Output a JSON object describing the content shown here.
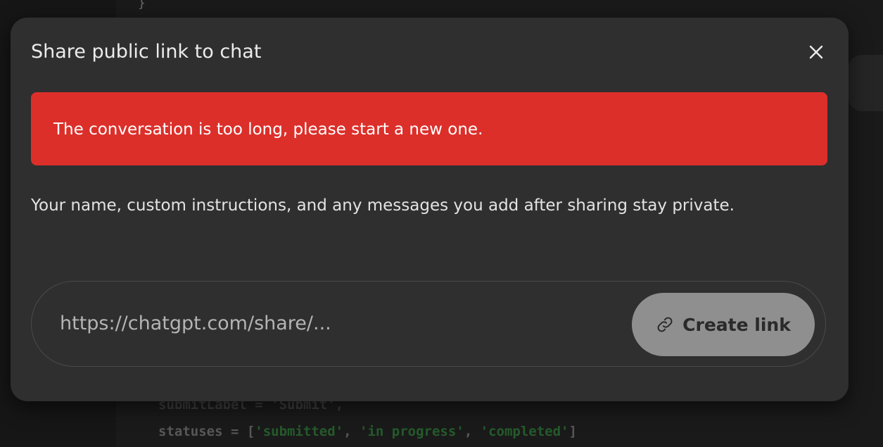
{
  "background_code": {
    "line1": "submitLabel = 'Submit',",
    "line2_prefix": "statuses = [",
    "status1": "'submitted'",
    "status2": "'in progress'",
    "status3": "'completed'",
    "line2_suffix": "]"
  },
  "dialog": {
    "title": "Share public link to chat",
    "close_icon": "close-icon",
    "error_message": "The conversation is too long, please start a new one.",
    "privacy_note": "Your name, custom instructions, and any messages you add after sharing stay private.",
    "link_placeholder": "https://chatgpt.com/share/...",
    "create_button_label": "Create link",
    "create_button_icon": "link-icon"
  },
  "colors": {
    "error_banner": "#dc2f2a",
    "dialog_bg": "#2f2f2f",
    "button_bg": "#8f8f8f"
  }
}
